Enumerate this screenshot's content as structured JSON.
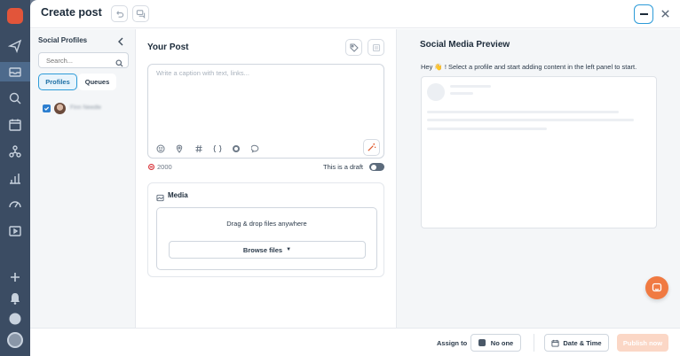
{
  "header": {
    "title": "Create post"
  },
  "left_panel": {
    "title": "Social Profiles",
    "search_placeholder": "Search...",
    "tabs": [
      {
        "label": "Profiles",
        "active": true
      },
      {
        "label": "Queues",
        "active": false
      }
    ],
    "profiles": [
      {
        "name": "Finn Needle",
        "checked": true
      }
    ]
  },
  "editor": {
    "title": "Your Post",
    "caption_placeholder": "Write a caption with text, links...",
    "char_count": "2000",
    "draft_label": "This is a draft",
    "draft_on": false,
    "media_title": "Media",
    "drop_text": "Drag & drop files anywhere",
    "browse_label": "Browse files"
  },
  "preview": {
    "title": "Social Media Preview",
    "subtitle": "Hey 👋 ! Select a profile and start adding content in the left panel to start."
  },
  "footer": {
    "assign_label": "Assign to",
    "assignee": "No one",
    "datetime_label": "Date & Time",
    "publish_label": "Publish now"
  },
  "colors": {
    "accent": "#2d9bd8",
    "brand_orange": "#f07a42",
    "publish_disabled": "#fbd7c6"
  }
}
